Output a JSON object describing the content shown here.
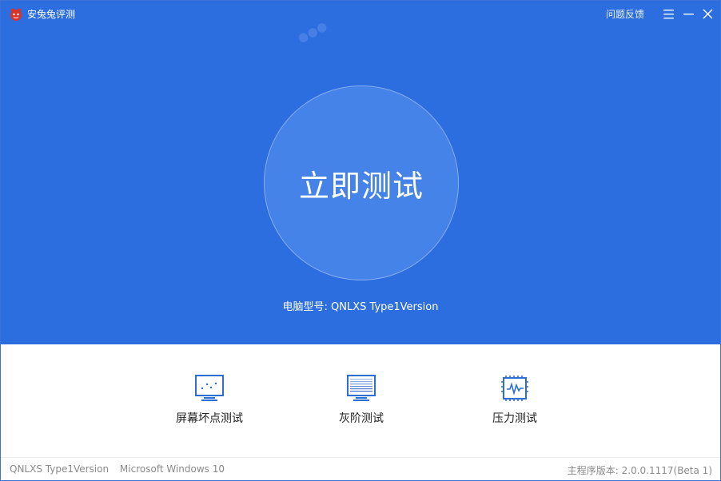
{
  "window": {
    "title": "安兔兔评测",
    "feedback_label": "问题反馈"
  },
  "hero": {
    "start_button_label": "立即测试",
    "model_label": "电脑型号:",
    "model_value": "QNLXS Type1Version"
  },
  "tools": [
    {
      "label": "屏幕坏点测试",
      "icon": "monitor-dots-icon"
    },
    {
      "label": "灰阶测试",
      "icon": "grayscale-icon"
    },
    {
      "label": "压力测试",
      "icon": "cpu-chip-icon"
    }
  ],
  "footer": {
    "device": "QNLXS Type1Version",
    "os": "Microsoft Windows 10",
    "version": "主程序版本: 2.0.0.1117(Beta 1)"
  },
  "colors": {
    "hero_blue": "#2c6ee0",
    "circle_blue": "#4583e8",
    "icon_blue": "#2b6fd6"
  }
}
